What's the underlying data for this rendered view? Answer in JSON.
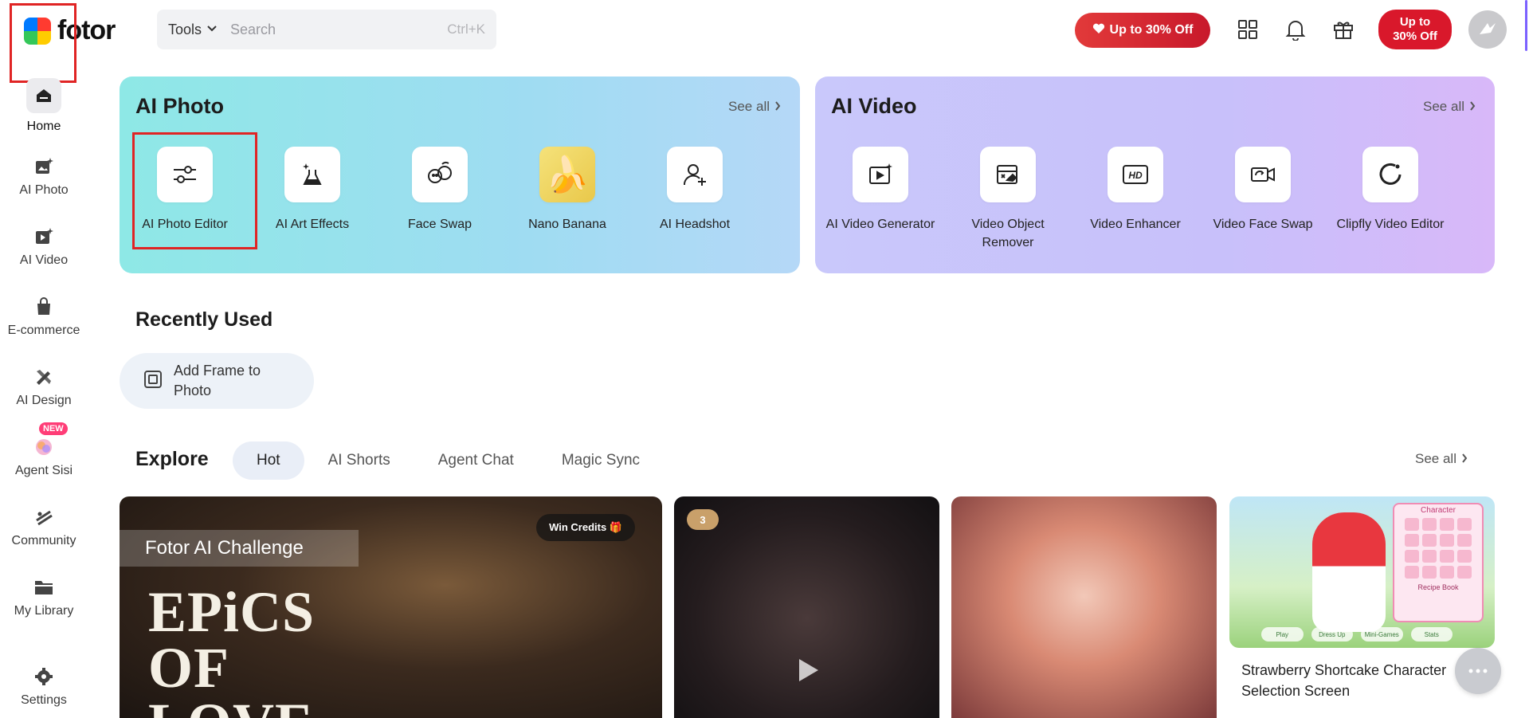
{
  "header": {
    "logo_text": "fotor",
    "tools_label": "Tools",
    "search_placeholder": "Search",
    "search_shortcut": "Ctrl+K",
    "promo_pill": "Up to 30% Off",
    "promo_button_line1": "Up to",
    "promo_button_line2": "30% Off",
    "accent_color": "#d9182b"
  },
  "sidebar": {
    "items": [
      {
        "label": "Home",
        "icon": "home-icon"
      },
      {
        "label": "AI Photo",
        "icon": "ai-photo-icon"
      },
      {
        "label": "AI Video",
        "icon": "ai-video-icon"
      },
      {
        "label": "E-commerce",
        "icon": "shopping-bag-icon"
      },
      {
        "label": "AI Design",
        "icon": "design-tools-icon"
      },
      {
        "label": "Agent Sisi",
        "icon": "agent-sisi-icon",
        "badge": "NEW"
      },
      {
        "label": "Community",
        "icon": "community-icon"
      },
      {
        "label": "My Library",
        "icon": "folder-icon"
      },
      {
        "label": "Settings",
        "icon": "gear-icon"
      }
    ]
  },
  "ai_photo": {
    "title": "AI Photo",
    "see_all": "See all",
    "tools": [
      {
        "label": "AI Photo Editor",
        "icon": "sliders-icon"
      },
      {
        "label": "AI Art Effects",
        "icon": "flask-sparkle-icon"
      },
      {
        "label": "Face Swap",
        "icon": "face-swap-icon"
      },
      {
        "label": "Nano Banana",
        "icon": "banana-icon"
      },
      {
        "label": "AI Headshot",
        "icon": "person-plus-icon"
      }
    ]
  },
  "ai_video": {
    "title": "AI Video",
    "see_all": "See all",
    "tools": [
      {
        "label": "AI Video Generator",
        "icon": "video-sparkle-icon"
      },
      {
        "label": "Video Object Remover",
        "icon": "eraser-icon"
      },
      {
        "label": "Video Enhancer",
        "icon": "hd-icon"
      },
      {
        "label": "Video Face Swap",
        "icon": "camera-swap-icon"
      },
      {
        "label": "Clipfly Video Editor",
        "icon": "clipfly-icon"
      }
    ]
  },
  "recently_used": {
    "title": "Recently Used",
    "items": [
      {
        "label": "Add Frame to Photo",
        "icon": "frame-icon"
      }
    ]
  },
  "explore": {
    "title": "Explore",
    "see_all": "See all",
    "tabs": [
      "Hot",
      "AI Shorts",
      "Agent Chat",
      "Magic Sync"
    ],
    "active_tab": "Hot",
    "cards": [
      {
        "overlay_title": "Fotor AI Challenge",
        "badge": "Win Credits 🎁",
        "headline_lines": [
          "EPiCS",
          "OF",
          "LOVE"
        ]
      },
      {
        "rank": "3"
      },
      {},
      {
        "title": "Strawberry Shortcake Character Selection Screen",
        "panel_title": "Character",
        "panel_subtitle": "Recipe Book",
        "buttons": [
          "Play",
          "Dress Up",
          "Mini-Games",
          "Stats"
        ]
      }
    ]
  }
}
